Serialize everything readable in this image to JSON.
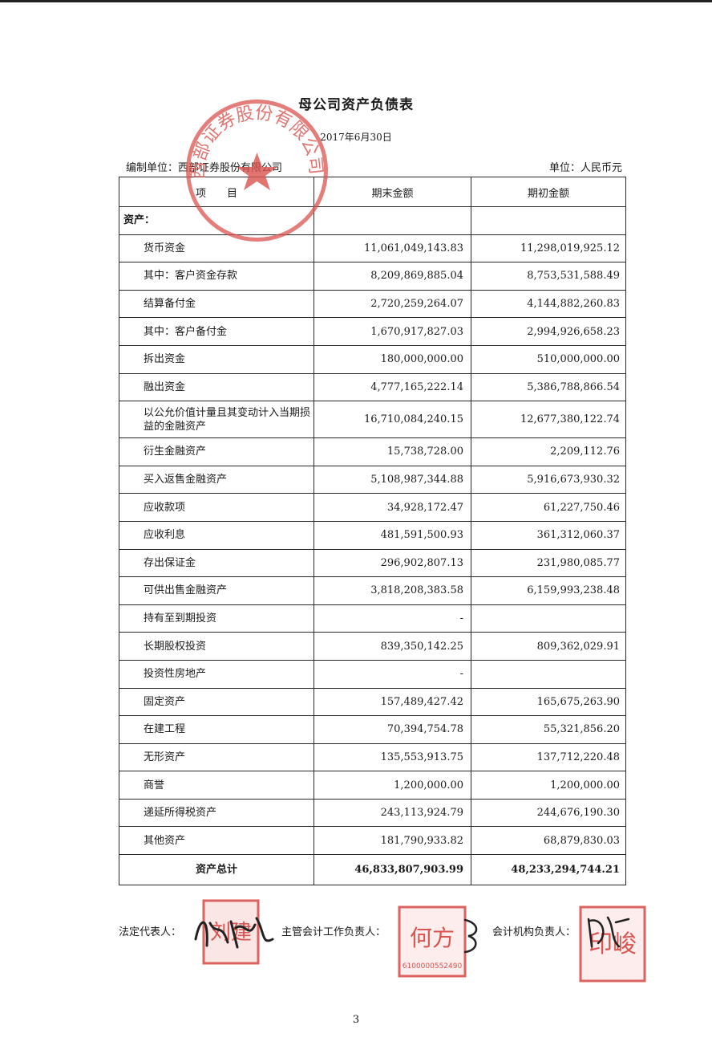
{
  "document": {
    "title": "母公司资产负债表",
    "date": "2017年6月30日",
    "prepared_by": "编制单位：西部证券股份有限公司",
    "currency_unit": "单位：人民币元",
    "page_number": "3"
  },
  "table": {
    "headers": [
      "项　　目",
      "期末金额",
      "期初金额"
    ],
    "section_label": "资产：",
    "rows": [
      {
        "item": "货币资金",
        "end": "11,061,049,143.83",
        "begin": "11,298,019,925.12"
      },
      {
        "item": "其中：客户资金存款",
        "end": "8,209,869,885.04",
        "begin": "8,753,531,588.49"
      },
      {
        "item": "结算备付金",
        "end": "2,720,259,264.07",
        "begin": "4,144,882,260.83"
      },
      {
        "item": "其中：客户备付金",
        "end": "1,670,917,827.03",
        "begin": "2,994,926,658.23"
      },
      {
        "item": "拆出资金",
        "end": "180,000,000.00",
        "begin": "510,000,000.00"
      },
      {
        "item": "融出资金",
        "end": "4,777,165,222.14",
        "begin": "5,386,788,866.54"
      },
      {
        "item": "以公允价值计量且其变动计入当期损益的金融资产",
        "end": "16,710,084,240.15",
        "begin": "12,677,380,122.74"
      },
      {
        "item": "衍生金融资产",
        "end": "15,738,728.00",
        "begin": "2,209,112.76"
      },
      {
        "item": "买入返售金融资产",
        "end": "5,108,987,344.88",
        "begin": "5,916,673,930.32"
      },
      {
        "item": "应收款项",
        "end": "34,928,172.47",
        "begin": "61,227,750.46"
      },
      {
        "item": "应收利息",
        "end": "481,591,500.93",
        "begin": "361,312,060.37"
      },
      {
        "item": "存出保证金",
        "end": "296,902,807.13",
        "begin": "231,980,085.77"
      },
      {
        "item": "可供出售金融资产",
        "end": "3,818,208,383.58",
        "begin": "6,159,993,238.48"
      },
      {
        "item": "持有至到期投资",
        "end": "-",
        "begin": ""
      },
      {
        "item": "长期股权投资",
        "end": "839,350,142.25",
        "begin": "809,362,029.91"
      },
      {
        "item": "投资性房地产",
        "end": "-",
        "begin": ""
      },
      {
        "item": "固定资产",
        "end": "157,489,427.42",
        "begin": "165,675,263.90"
      },
      {
        "item": "在建工程",
        "end": "70,394,754.78",
        "begin": "55,321,856.20"
      },
      {
        "item": "无形资产",
        "end": "135,553,913.75",
        "begin": "137,712,220.48"
      },
      {
        "item": "商誉",
        "end": "1,200,000.00",
        "begin": "1,200,000.00"
      },
      {
        "item": "递延所得税资产",
        "end": "243,113,924.79",
        "begin": "244,676,190.30"
      },
      {
        "item": "其他资产",
        "end": "181,790,933.82",
        "begin": "68,879,830.03"
      }
    ],
    "total": {
      "item": "资产总计",
      "end": "46,833,807,903.99",
      "begin": "48,233,294,744.21"
    }
  },
  "signatures": {
    "legal_rep_label": "法定代表人：",
    "accounting_head_label": "主管会计工作负责人：",
    "accounting_org_label": "会计机构负责人："
  },
  "seals": {
    "company_seal_text": "西部证券股份有限公司",
    "legal_rep_seal": "刘建",
    "accounting_head_seal": "何方",
    "accounting_head_seal_id": "6100000552490",
    "accounting_org_seal": "印峻",
    "seal_color": "#d9534f"
  }
}
